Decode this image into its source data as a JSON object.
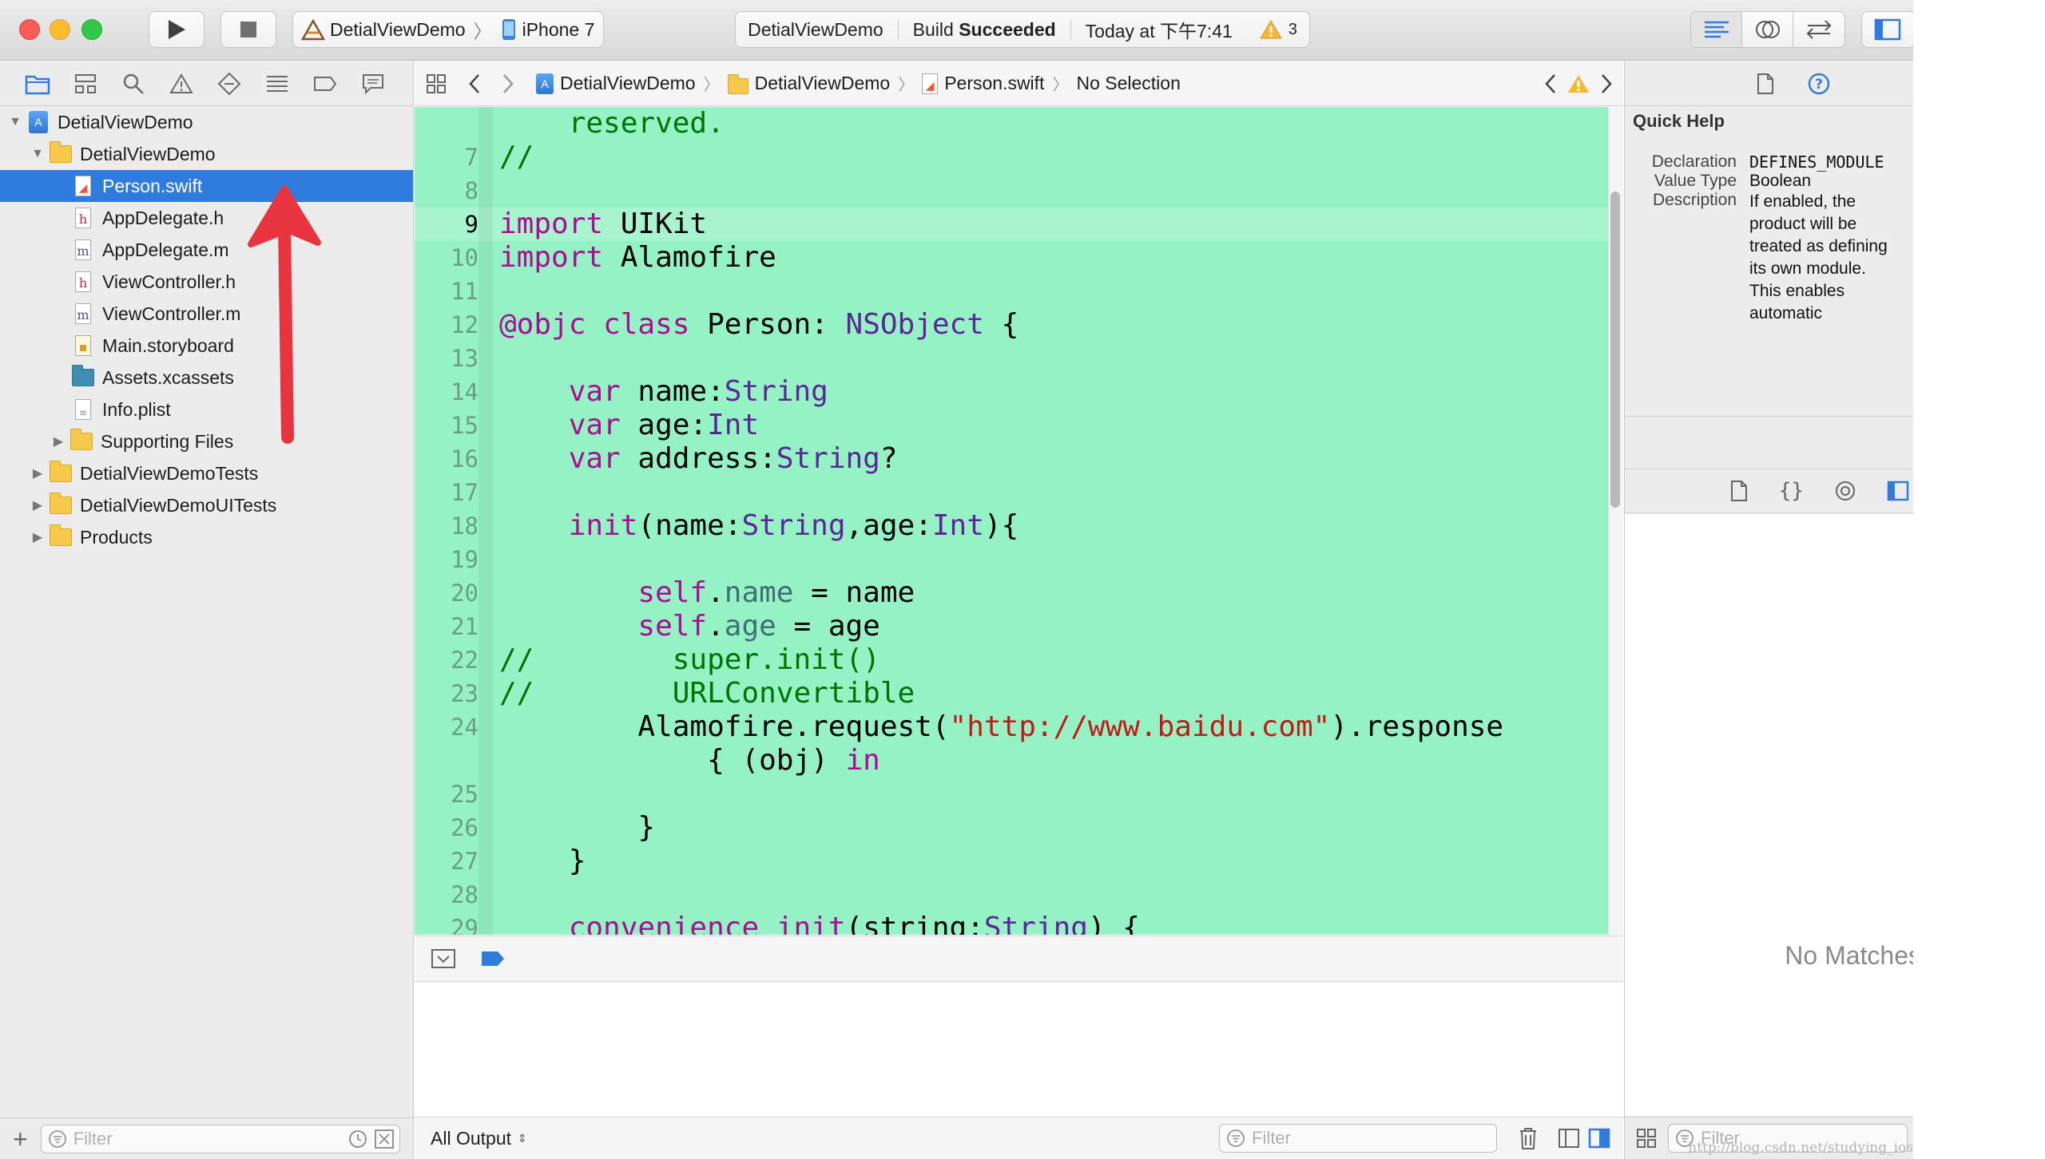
{
  "toolbar": {
    "scheme": {
      "target": "DetialViewDemo",
      "device": "iPhone 7"
    },
    "activity": {
      "project": "DetialViewDemo",
      "status_prefix": "Build",
      "status_result": "Succeeded",
      "time": "Today at 下午7:41",
      "warning_count": "3"
    }
  },
  "navigator": {
    "tree": [
      {
        "label": "DetialViewDemo",
        "icon": "project-icon",
        "level": 0,
        "disclosure": "▼"
      },
      {
        "label": "DetialViewDemo",
        "icon": "folder-icon",
        "level": 1,
        "disclosure": "▼"
      },
      {
        "label": "Person.swift",
        "icon": "swift-file-icon",
        "level": 2,
        "selected": true
      },
      {
        "label": "AppDelegate.h",
        "icon": "header-file-icon",
        "level": 2
      },
      {
        "label": "AppDelegate.m",
        "icon": "objc-file-icon",
        "level": 2
      },
      {
        "label": "ViewController.h",
        "icon": "header-file-icon",
        "level": 2
      },
      {
        "label": "ViewController.m",
        "icon": "objc-file-icon",
        "level": 2
      },
      {
        "label": "Main.storyboard",
        "icon": "storyboard-file-icon",
        "level": 2
      },
      {
        "label": "Assets.xcassets",
        "icon": "assets-folder-icon",
        "level": 2
      },
      {
        "label": "Info.plist",
        "icon": "plist-file-icon",
        "level": 2
      },
      {
        "label": "Supporting Files",
        "icon": "folder-icon",
        "level": 2,
        "disclosure": "▶"
      },
      {
        "label": "DetialViewDemoTests",
        "icon": "folder-icon",
        "level": 1,
        "disclosure": "▶"
      },
      {
        "label": "DetialViewDemoUITests",
        "icon": "folder-icon",
        "level": 1,
        "disclosure": "▶"
      },
      {
        "label": "Products",
        "icon": "folder-icon",
        "level": 1,
        "disclosure": "▶"
      }
    ],
    "filter_placeholder": "Filter"
  },
  "jumpbar": {
    "crumbs": [
      "DetialViewDemo",
      "DetialViewDemo",
      "Person.swift",
      "No Selection"
    ]
  },
  "editor": {
    "line_numbers": [
      "",
      "7",
      "8",
      "9",
      "10",
      "11",
      "12",
      "13",
      "14",
      "15",
      "16",
      "17",
      "18",
      "19",
      "20",
      "21",
      "22",
      "23",
      "24",
      "",
      "25",
      "26",
      "27",
      "28",
      "29"
    ],
    "current_line": "9"
  },
  "debug": {
    "output_selector": "All Output",
    "filter_placeholder": "Filter"
  },
  "inspector": {
    "quick_help_title": "Quick Help",
    "declaration_label": "Declaration",
    "declaration_value": "DEFINES_MODULE",
    "value_type_label": "Value Type",
    "value_type_value": "Boolean",
    "description_label": "Description",
    "description_value": "If enabled, the product will be treated as defining its own module. This enables automatic production of LLVM module map files when appropriate, and allows the product to be imported as a module.",
    "library_empty": "No Matches",
    "filter_placeholder": "Filter"
  },
  "watermark": "http://blog.csdn.net/studying_ios",
  "colors": {
    "editor_background": "#95f2c5",
    "selection": "#2f7bde",
    "keyword": "#aa0d91",
    "type": "#5c2699",
    "string": "#c41a16",
    "comment": "#007400",
    "arrow": "#e8343f"
  }
}
